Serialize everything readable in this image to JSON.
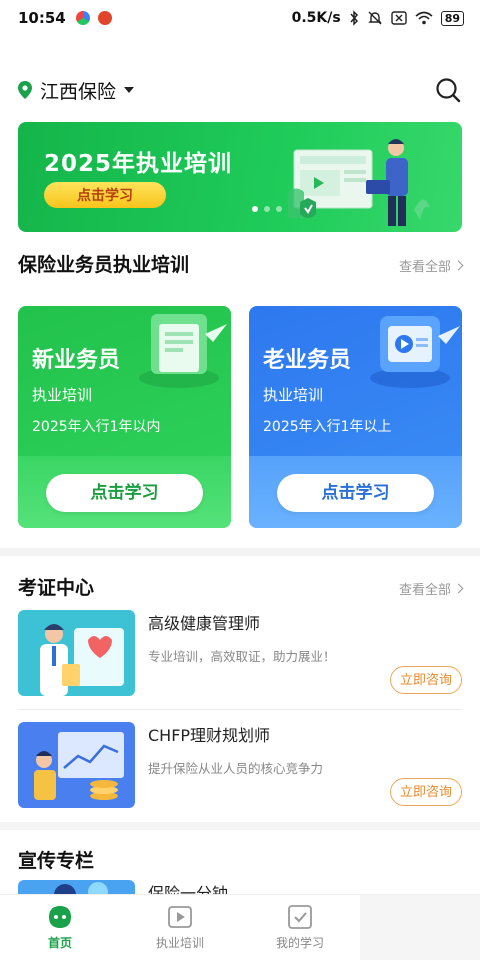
{
  "status": {
    "time": "10:54",
    "speed": "0.5K/s",
    "battery": "89"
  },
  "header": {
    "city": "江西保险"
  },
  "banner": {
    "title": "2025年执业培训",
    "button": "点击学习",
    "slides": 3,
    "active_slide": 1
  },
  "training": {
    "title": "保险业务员执业培训",
    "more": "查看全部",
    "cards": [
      {
        "name": "新业务员",
        "sub": "执业培训",
        "desc": "2025年入行1年以内",
        "button": "点击学习"
      },
      {
        "name": "老业务员",
        "sub": "执业培训",
        "desc": "2025年入行1年以上",
        "button": "点击学习"
      }
    ]
  },
  "certs": {
    "title": "考证中心",
    "more": "查看全部",
    "items": [
      {
        "title": "高级健康管理师",
        "desc": "专业培训，高效取证，助力展业！",
        "button": "立即咨询"
      },
      {
        "title": "CHFP理财规划师",
        "desc": "提升保险从业人员的核心竞争力",
        "button": "立即咨询"
      }
    ]
  },
  "promo": {
    "title": "宣传专栏",
    "first_item": "保险一分钟"
  },
  "tabs": [
    {
      "label": "首页",
      "active": true
    },
    {
      "label": "执业培训",
      "active": false
    },
    {
      "label": "我的学习",
      "active": false
    }
  ],
  "colors": {
    "accent": "#1aa24a",
    "orange": "#e98a2a"
  }
}
